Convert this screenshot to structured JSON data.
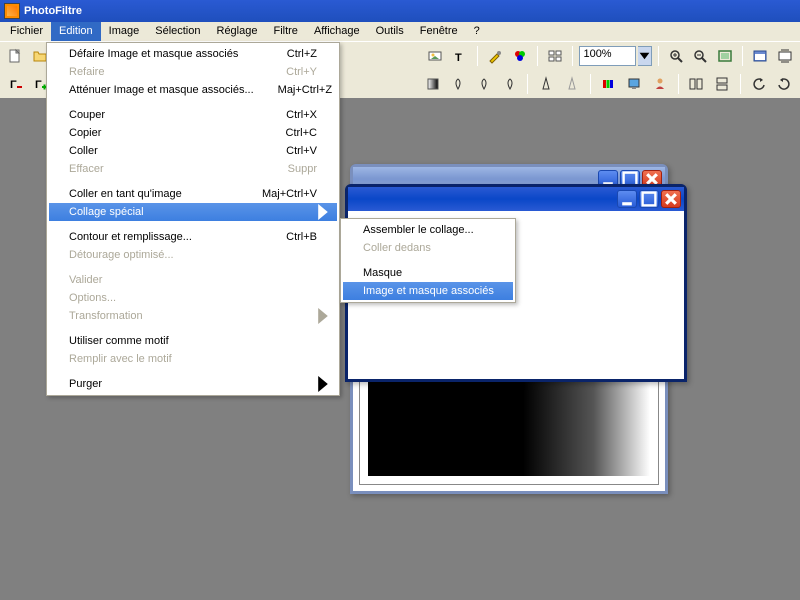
{
  "app_title": "PhotoFiltre",
  "menubar": [
    {
      "label": "Fichier"
    },
    {
      "label": "Edition",
      "active": true
    },
    {
      "label": "Image"
    },
    {
      "label": "Sélection"
    },
    {
      "label": "Réglage"
    },
    {
      "label": "Filtre"
    },
    {
      "label": "Affichage"
    },
    {
      "label": "Outils"
    },
    {
      "label": "Fenêtre"
    },
    {
      "label": "?"
    }
  ],
  "zoom_value": "100%",
  "edition_menu": [
    {
      "label": "Défaire Image et masque associés",
      "shortcut": "Ctrl+Z"
    },
    {
      "label": "Refaire",
      "shortcut": "Ctrl+Y",
      "disabled": true
    },
    {
      "label": "Atténuer Image et masque associés...",
      "shortcut": "Maj+Ctrl+Z"
    },
    {
      "sep": true
    },
    {
      "label": "Couper",
      "shortcut": "Ctrl+X"
    },
    {
      "label": "Copier",
      "shortcut": "Ctrl+C"
    },
    {
      "label": "Coller",
      "shortcut": "Ctrl+V"
    },
    {
      "label": "Effacer",
      "shortcut": "Suppr",
      "disabled": true
    },
    {
      "sep": true
    },
    {
      "label": "Coller en tant qu'image",
      "shortcut": "Maj+Ctrl+V"
    },
    {
      "label": "Collage spécial",
      "submenu": true,
      "highlighted": true
    },
    {
      "sep": true
    },
    {
      "label": "Contour et remplissage...",
      "shortcut": "Ctrl+B"
    },
    {
      "label": "Détourage optimisé...",
      "disabled": true
    },
    {
      "sep": true
    },
    {
      "label": "Valider",
      "disabled": true
    },
    {
      "label": "Options...",
      "disabled": true
    },
    {
      "label": "Transformation",
      "submenu": true,
      "disabled": true
    },
    {
      "sep": true
    },
    {
      "label": "Utiliser comme motif"
    },
    {
      "label": "Remplir avec le motif",
      "disabled": true
    },
    {
      "sep": true
    },
    {
      "label": "Purger",
      "submenu": true
    }
  ],
  "collage_submenu": [
    {
      "label": "Assembler le collage..."
    },
    {
      "label": "Coller dedans",
      "disabled": true
    },
    {
      "sep": true
    },
    {
      "label": "Masque"
    },
    {
      "label": "Image et masque associés",
      "highlighted": true
    }
  ]
}
